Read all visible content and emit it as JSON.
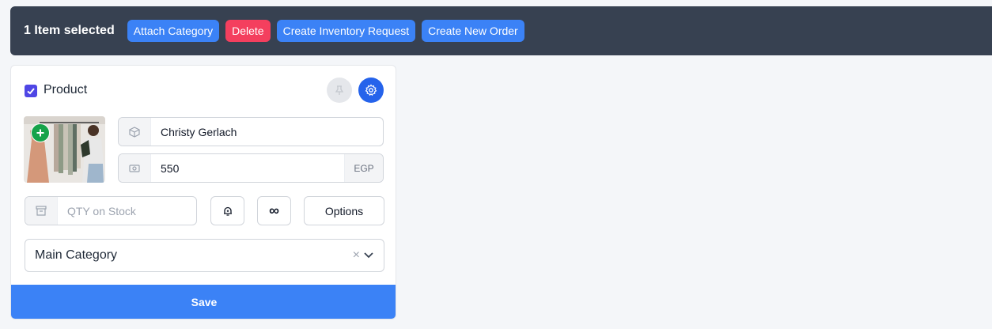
{
  "bulk_bar": {
    "selection_label": "1 Item selected",
    "actions": [
      {
        "label": "Attach Category",
        "color": "#3b82f6"
      },
      {
        "label": "Delete",
        "color": "#f43f5e"
      },
      {
        "label": "Create Inventory Request",
        "color": "#3b82f6"
      },
      {
        "label": "Create New Order",
        "color": "#3b82f6"
      }
    ]
  },
  "product_card": {
    "checked": true,
    "title": "Product",
    "icons": {
      "pin": "pin-icon",
      "settings": "gear-icon",
      "add_image": "plus-icon"
    },
    "name_field": {
      "icon": "box-icon",
      "value": "Christy Gerlach"
    },
    "price_field": {
      "icon": "banknote-icon",
      "value": "550",
      "currency": "EGP"
    },
    "qty_field": {
      "icon": "archive-icon",
      "placeholder": "QTY on Stock"
    },
    "bell_icon": "bell-icon",
    "infinity_label": "∞",
    "options_label": "Options",
    "category_select": {
      "value": "Main Category",
      "clear": "×"
    },
    "save_label": "Save"
  },
  "colors": {
    "accent": "#3b82f6",
    "danger": "#f43f5e",
    "topbar": "#374151",
    "success": "#16a34a"
  }
}
